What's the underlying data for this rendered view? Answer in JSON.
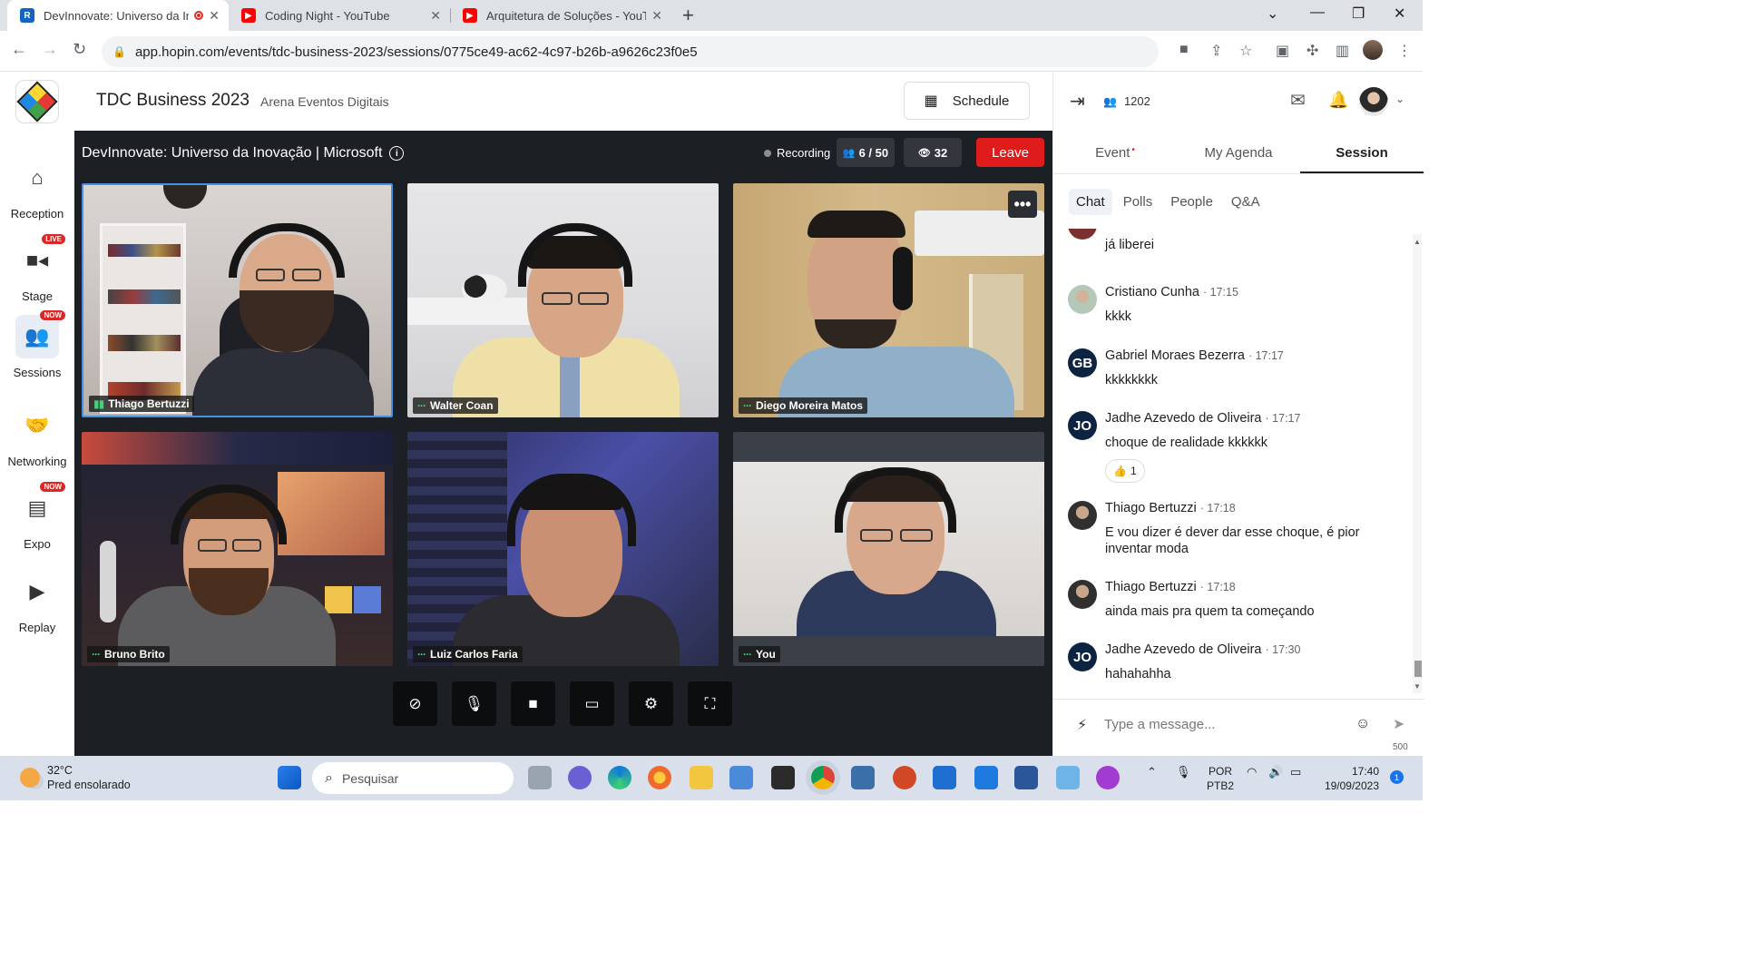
{
  "browser": {
    "tabs": [
      {
        "title": "DevInnovate: Universo da Inovação",
        "favicon": "hopin-favicon",
        "active": true
      },
      {
        "title": "Coding Night - YouTube",
        "favicon": "youtube-favicon",
        "active": false
      },
      {
        "title": "Arquitetura de Soluções - YouTube",
        "favicon": "youtube-favicon",
        "active": false
      }
    ],
    "url": "app.hopin.com/events/tdc-business-2023/sessions/0775ce49-ac62-4c97-b26b-a9626c23f0e5"
  },
  "left_nav": {
    "items": [
      {
        "label": "Reception",
        "icon": "home-icon"
      },
      {
        "label": "Stage",
        "icon": "video-camera-icon",
        "badge": "LIVE"
      },
      {
        "label": "Sessions",
        "icon": "group-icon",
        "badge": "NOW",
        "active": true
      },
      {
        "label": "Networking",
        "icon": "handshake-icon"
      },
      {
        "label": "Expo",
        "icon": "store-icon",
        "badge": "NOW"
      },
      {
        "label": "Replay",
        "icon": "play-circle-icon"
      }
    ]
  },
  "header": {
    "event_title": "TDC Business 2023",
    "organizer": "Arena Eventos Digitais",
    "schedule_label": "Schedule"
  },
  "stage": {
    "session_title": "DevInnovate: Universo da Inovação | Microsoft",
    "recording_label": "Recording",
    "participants": "6 / 50",
    "viewers": "32",
    "leave_label": "Leave",
    "tiles": [
      {
        "name": "Thiago Bertuzzi"
      },
      {
        "name": "Walter Coan"
      },
      {
        "name": "Diego Moreira Matos"
      },
      {
        "name": "Bruno Brito"
      },
      {
        "name": "Luiz Carlos Faria"
      },
      {
        "name": "You"
      }
    ],
    "controls": [
      "camera-off-icon",
      "microphone-icon",
      "video-camera-icon",
      "screen-share-icon",
      "settings-icon",
      "fullscreen-icon"
    ]
  },
  "right_panel": {
    "attendees": "1202",
    "tabs": [
      {
        "label": "Event"
      },
      {
        "label": "My Agenda"
      },
      {
        "label": "Session",
        "active": true
      }
    ],
    "subtabs": [
      {
        "label": "Chat",
        "active": true
      },
      {
        "label": "Polls"
      },
      {
        "label": "People"
      },
      {
        "label": "Q&A"
      }
    ],
    "messages": [
      {
        "author": "",
        "time": "",
        "text": "já liberei"
      },
      {
        "author": "Cristiano Cunha",
        "time": "17:15",
        "text": "kkkk"
      },
      {
        "author": "Gabriel Moraes Bezerra",
        "time": "17:17",
        "text": "kkkkkkkk",
        "initials": "GB"
      },
      {
        "author": "Jadhe Azevedo de Oliveira",
        "time": "17:17",
        "text": "choque de realidade kkkkkk",
        "initials": "JO",
        "reaction": "1"
      },
      {
        "author": "Thiago Bertuzzi",
        "time": "17:18",
        "text": "E vou dizer é dever dar esse choque, é pior inventar moda"
      },
      {
        "author": "Thiago Bertuzzi",
        "time": "17:18",
        "text": "ainda mais pra quem ta começando"
      },
      {
        "author": "Jadhe Azevedo de Oliveira",
        "time": "17:30",
        "text": "hahahahha",
        "initials": "JO"
      }
    ],
    "composer": {
      "placeholder": "Type a message...",
      "char_limit": "500"
    }
  },
  "taskbar": {
    "weather_temp": "32°C",
    "weather_desc": "Pred ensolarado",
    "search_placeholder": "Pesquisar",
    "lang_line1": "POR",
    "lang_line2": "PTB2",
    "time": "17:40",
    "date": "19/09/2023",
    "notifications": "1"
  }
}
